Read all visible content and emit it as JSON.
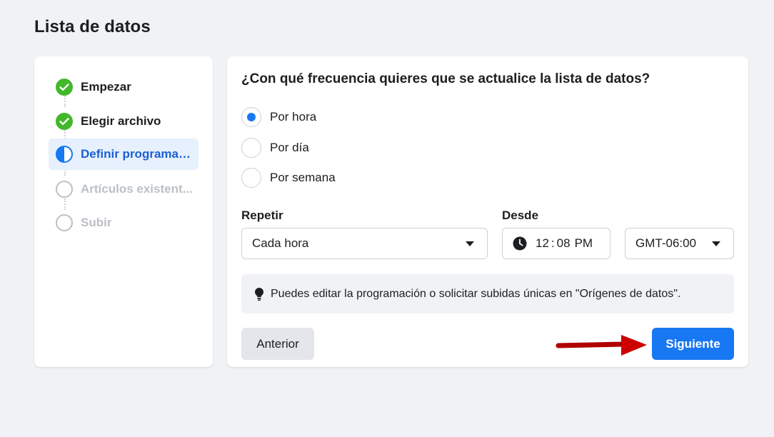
{
  "page": {
    "title": "Lista de datos"
  },
  "steps": [
    {
      "label": "Empezar",
      "state": "done"
    },
    {
      "label": "Elegir archivo",
      "state": "done"
    },
    {
      "label": "Definir programac...",
      "state": "active"
    },
    {
      "label": "Artículos existent...",
      "state": "todo"
    },
    {
      "label": "Subir",
      "state": "todo"
    }
  ],
  "main": {
    "question": "¿Con qué frecuencia quieres que se actualice la lista de datos?",
    "options": [
      {
        "label": "Por hora",
        "checked": true
      },
      {
        "label": "Por día",
        "checked": false
      },
      {
        "label": "Por semana",
        "checked": false
      }
    ],
    "repeat": {
      "label": "Repetir",
      "value": "Cada hora"
    },
    "from": {
      "label": "Desde",
      "hour": "12",
      "separator": ":",
      "minute": "08",
      "period": "PM",
      "timezone": "GMT-06:00"
    },
    "info": "Puedes editar la programación o solicitar subidas únicas en \"Orígenes de datos\".",
    "buttons": {
      "previous": "Anterior",
      "next": "Siguiente"
    }
  },
  "colors": {
    "accent": "#1877f2",
    "done": "#42b72a",
    "active_text": "#1b5fd6",
    "active_bg": "#e7f0fd",
    "arrow": "#cc0000"
  }
}
